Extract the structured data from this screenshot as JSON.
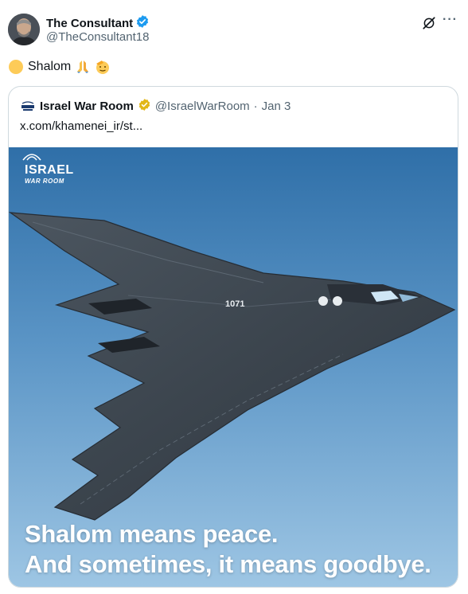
{
  "author": {
    "display_name": "The Consultant",
    "handle": "@TheConsultant18",
    "avatar_icon": "avatar-photo",
    "verified_icon": "blue-verified-badge-icon"
  },
  "tweet": {
    "text": "Shalom",
    "emojis": [
      "yellow-circle-emoji",
      "folded-hands-emoji",
      "saluting-face-emoji"
    ]
  },
  "header_icons": [
    "grok-icon",
    "more-options-icon"
  ],
  "quote": {
    "display_name": "Israel War Room",
    "handle": "@IsraelWarRoom",
    "separator": "·",
    "date": "Jan 3",
    "link": "x.com/khamenei_ir/st...",
    "verified_icon": "gold-verified-badge-icon",
    "media": {
      "watermark_top": "ISRAEL",
      "watermark_bottom": "WAR ROOM",
      "aircraft_marking": "1071",
      "caption_line1": "Shalom means peace.",
      "caption_line2": "And sometimes, it means goodbye."
    }
  },
  "colors": {
    "text": "#0f1419",
    "secondary": "#536471",
    "border": "#cfd9de",
    "verified_blue": "#1d9bf0",
    "verified_gold": "#e2b719",
    "sky_top": "#2f6fa8",
    "sky_bottom": "#9ec6e4"
  }
}
